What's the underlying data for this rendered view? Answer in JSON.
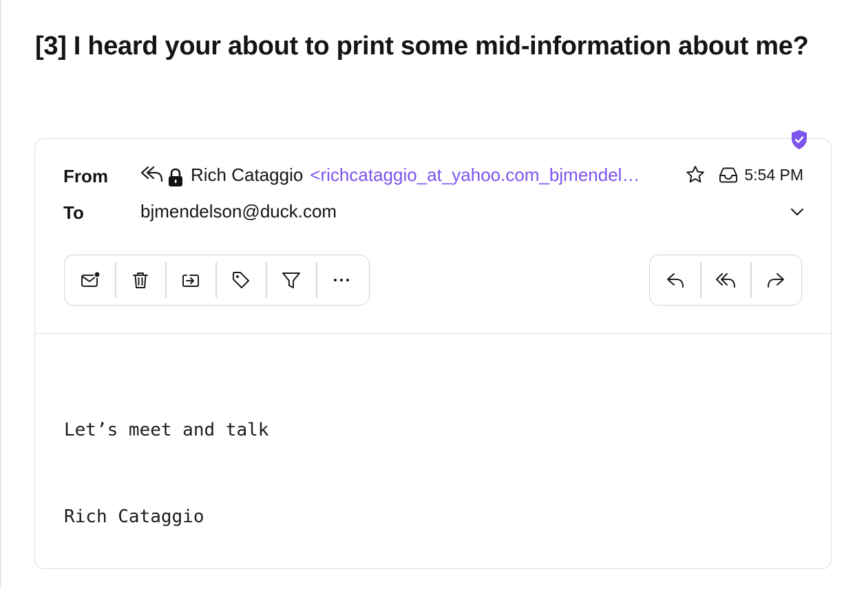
{
  "email": {
    "subject": "[3] I heard your about to print some mid-information about me?",
    "from_label": "From",
    "to_label": "To",
    "sender_name": "Rich Cataggio",
    "sender_email": "<richcataggio_at_yahoo.com_bjmendelson@duck.com>",
    "recipient": "bjmendelson@duck.com",
    "time": "5:54 PM",
    "body_lines": [
      "Let’s meet and talk",
      "Rich Cataggio"
    ]
  },
  "icons": {
    "verified": "shield-check-icon",
    "status": "reply-all-icon",
    "security": "lock-icon",
    "star": "star-icon",
    "folder": "inbox-icon",
    "expand": "chevron-down-icon"
  },
  "toolbar_left": [
    "mark-unread",
    "trash",
    "move-to-folder",
    "label",
    "filter",
    "more"
  ],
  "toolbar_right": [
    "reply",
    "reply-all",
    "forward"
  ],
  "colors": {
    "accent": "#7c55ec",
    "text": "#141414",
    "border": "#dcdcdc"
  }
}
